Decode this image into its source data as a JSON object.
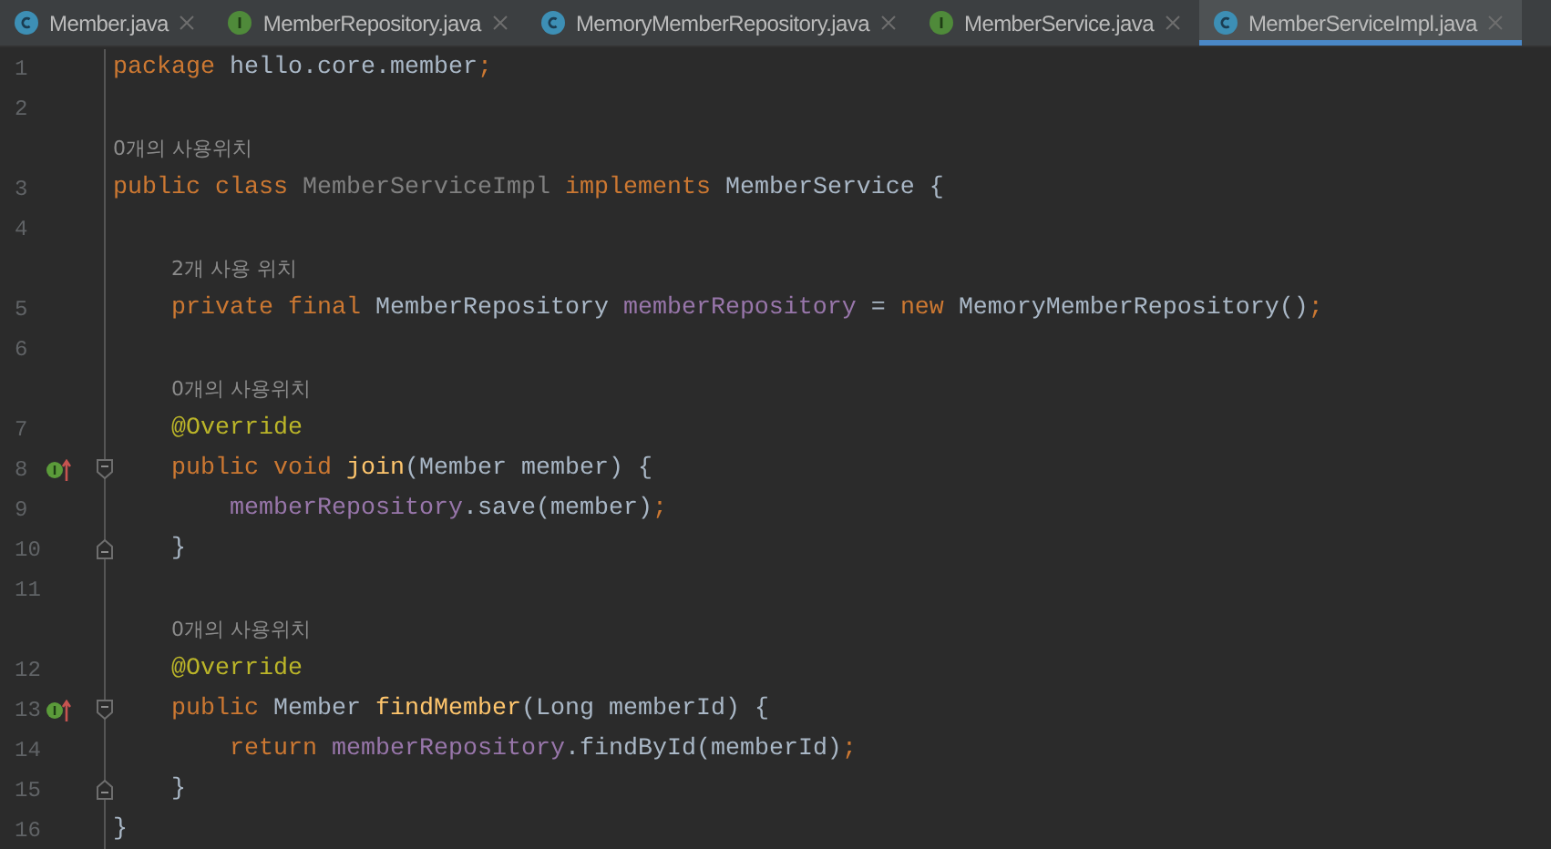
{
  "tabs": [
    {
      "label": "Member.java",
      "kind": "class",
      "selected": false
    },
    {
      "label": "MemberRepository.java",
      "kind": "interface",
      "selected": false
    },
    {
      "label": "MemoryMemberRepository.java",
      "kind": "class",
      "selected": false
    },
    {
      "label": "MemberService.java",
      "kind": "interface",
      "selected": false
    },
    {
      "label": "MemberServiceImpl.java",
      "kind": "class",
      "selected": true
    }
  ],
  "lines": [
    {
      "number": "1",
      "tokens": [
        {
          "t": "package",
          "kind": "kw"
        },
        {
          "t": " hello.core.member",
          "kind": "plain"
        },
        {
          "t": ";",
          "kind": "kw"
        }
      ]
    },
    {
      "number": "2"
    },
    {
      "number": "3",
      "hint": "0개의 사용위치",
      "tokens": [
        {
          "t": "public class ",
          "kind": "kw"
        },
        {
          "t": "MemberServiceImpl",
          "kind": "unused"
        },
        {
          "t": " implements ",
          "kind": "kw"
        },
        {
          "t": "MemberService",
          "kind": "plain"
        },
        {
          "t": " {",
          "kind": "plain"
        }
      ]
    },
    {
      "number": "4"
    },
    {
      "number": "5",
      "hint": "2개 사용 위치",
      "tokens": [
        {
          "t": "    private final ",
          "kind": "kw"
        },
        {
          "t": "MemberRepository ",
          "kind": "plain"
        },
        {
          "t": "memberRepository",
          "kind": "field"
        },
        {
          "t": " = ",
          "kind": "plain"
        },
        {
          "t": "new ",
          "kind": "kw"
        },
        {
          "t": "MemoryMemberRepository()",
          "kind": "plain"
        },
        {
          "t": ";",
          "kind": "kw"
        }
      ]
    },
    {
      "number": "6"
    },
    {
      "number": "7",
      "hint": "0개의 사용위치",
      "tokens": [
        {
          "t": "    @Override",
          "kind": "annotation"
        }
      ]
    },
    {
      "number": "8",
      "implements_marker": true,
      "fold_open": true,
      "tokens": [
        {
          "t": "    public void ",
          "kind": "kw"
        },
        {
          "t": "join",
          "kind": "method"
        },
        {
          "t": "(Member member) {",
          "kind": "plain"
        }
      ]
    },
    {
      "number": "9",
      "tokens": [
        {
          "t": "        memberRepository",
          "kind": "field"
        },
        {
          "t": ".save(member)",
          "kind": "plain"
        },
        {
          "t": ";",
          "kind": "kw"
        }
      ]
    },
    {
      "number": "10",
      "fold_close": true,
      "tokens": [
        {
          "t": "    }",
          "kind": "plain"
        }
      ]
    },
    {
      "number": "11"
    },
    {
      "number": "12",
      "hint": "0개의 사용위치",
      "tokens": [
        {
          "t": "    @Override",
          "kind": "annotation"
        }
      ]
    },
    {
      "number": "13",
      "implements_marker": true,
      "fold_open": true,
      "tokens": [
        {
          "t": "    public ",
          "kind": "kw"
        },
        {
          "t": "Member ",
          "kind": "plain"
        },
        {
          "t": "findMember",
          "kind": "method"
        },
        {
          "t": "(Long memberId) {",
          "kind": "plain"
        }
      ]
    },
    {
      "number": "14",
      "tokens": [
        {
          "t": "        return ",
          "kind": "kw"
        },
        {
          "t": "memberRepository",
          "kind": "field"
        },
        {
          "t": ".findById(memberId)",
          "kind": "plain"
        },
        {
          "t": ";",
          "kind": "kw"
        }
      ]
    },
    {
      "number": "15",
      "fold_close": true,
      "tokens": [
        {
          "t": "    }",
          "kind": "plain"
        }
      ]
    },
    {
      "number": "16",
      "tokens": [
        {
          "t": "}",
          "kind": "plain"
        }
      ]
    }
  ]
}
